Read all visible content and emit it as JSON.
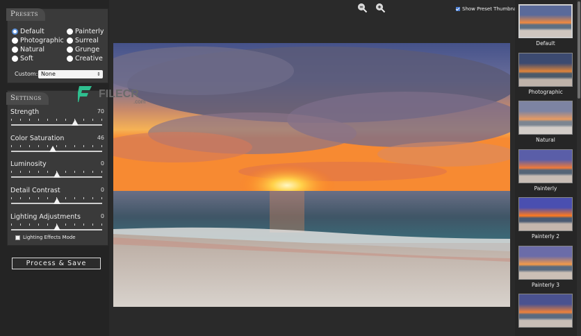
{
  "presets": {
    "title": "Presets",
    "options": [
      {
        "label": "Default",
        "selected": true
      },
      {
        "label": "Photographic",
        "selected": false
      },
      {
        "label": "Natural",
        "selected": false
      },
      {
        "label": "Soft",
        "selected": false
      },
      {
        "label": "Painterly",
        "selected": false
      },
      {
        "label": "Surreal",
        "selected": false
      },
      {
        "label": "Grunge",
        "selected": false
      },
      {
        "label": "Creative",
        "selected": false
      }
    ],
    "custom_label": "Custom:",
    "custom_value": "None"
  },
  "settings": {
    "title": "Settings",
    "sliders": [
      {
        "label": "Strength",
        "value": "70",
        "position": 0.7
      },
      {
        "label": "Color Saturation",
        "value": "46",
        "position": 0.46
      },
      {
        "label": "Luminosity",
        "value": "0",
        "position": 0.5
      },
      {
        "label": "Detail Contrast",
        "value": "0",
        "position": 0.5
      },
      {
        "label": "Lighting Adjustments",
        "value": "0",
        "position": 0.5
      }
    ],
    "lighting_effects_label": "Lighting Effects Mode",
    "lighting_effects_checked": false
  },
  "process_button": "Process & Save",
  "toolbar": {
    "zoom_out_icon": "zoom-out-icon",
    "zoom_in_icon": "zoom-in-icon",
    "show_thumbnails_label": "Show Preset Thumbnails",
    "show_thumbnails_checked": true
  },
  "watermark": {
    "text": "FILECR",
    "sub": ".com"
  },
  "thumbnails": [
    {
      "label": "Default",
      "selected": true
    },
    {
      "label": "Photographic",
      "selected": false
    },
    {
      "label": "Natural",
      "selected": false
    },
    {
      "label": "Painterly",
      "selected": false
    },
    {
      "label": "Painterly 2",
      "selected": false
    },
    {
      "label": "Painterly 3",
      "selected": false
    },
    {
      "label": "",
      "selected": false
    }
  ],
  "colors": {
    "accent": "#5a8fd8",
    "panel": "#3a3a3a",
    "background": "#1e1e1e"
  }
}
